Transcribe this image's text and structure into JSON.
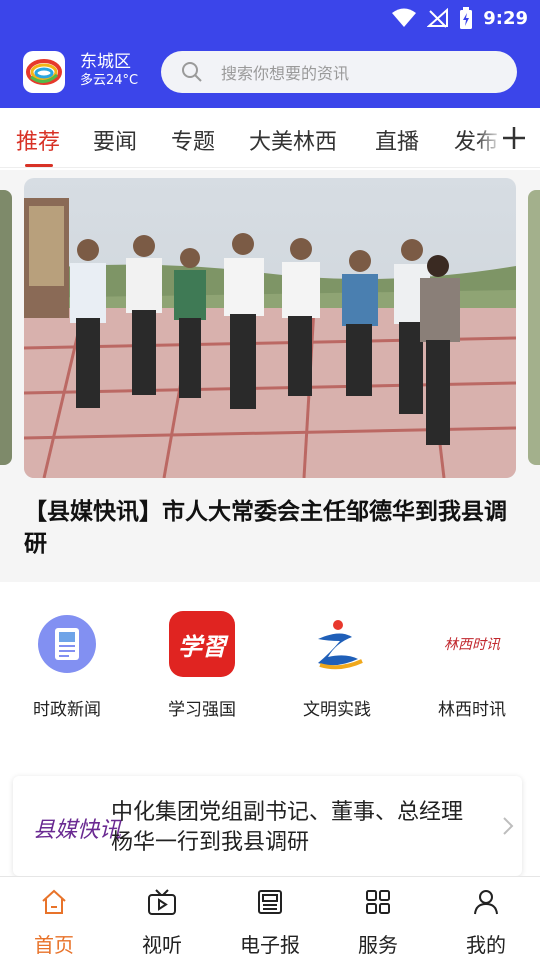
{
  "status_bar": {
    "time": "9:29"
  },
  "header": {
    "location": {
      "city": "东城区",
      "weather": "多云24°C"
    },
    "search": {
      "placeholder": "搜索你想要的资讯"
    }
  },
  "tabs": {
    "items": [
      {
        "label": "推荐",
        "active": true
      },
      {
        "label": "要闻"
      },
      {
        "label": "专题"
      },
      {
        "label": "大美林西"
      },
      {
        "label": "直播"
      },
      {
        "label": "发布"
      }
    ]
  },
  "featured": {
    "headline": "【县媒快讯】市人大常委会主任邹德华到我县调研"
  },
  "quick_links": [
    {
      "label": "时政新闻",
      "icon": "document-icon",
      "color": "#7f8cf0"
    },
    {
      "label": "学习强国",
      "icon": "xuexi-logo",
      "color": "#e02421",
      "logo_text": "学習"
    },
    {
      "label": "文明实践",
      "icon": "wenming-logo",
      "color": "#1f5fb8"
    },
    {
      "label": "林西时讯",
      "icon": "linxi-logo",
      "color": "#c1272d",
      "logo_text": "林西时讯"
    }
  ],
  "news_card": {
    "brand": "县媒快讯",
    "title": "中化集团党组副书记、董事、总经理杨华一行到我县调研"
  },
  "bottom_nav": [
    {
      "label": "首页",
      "icon": "home-icon",
      "active": true
    },
    {
      "label": "视听",
      "icon": "tv-icon"
    },
    {
      "label": "电子报",
      "icon": "newspaper-icon"
    },
    {
      "label": "服务",
      "icon": "grid-icon"
    },
    {
      "label": "我的",
      "icon": "user-icon"
    }
  ],
  "colors": {
    "header_blue": "#3b45ea",
    "tab_active": "#d83226",
    "nav_active": "#e8732a"
  }
}
